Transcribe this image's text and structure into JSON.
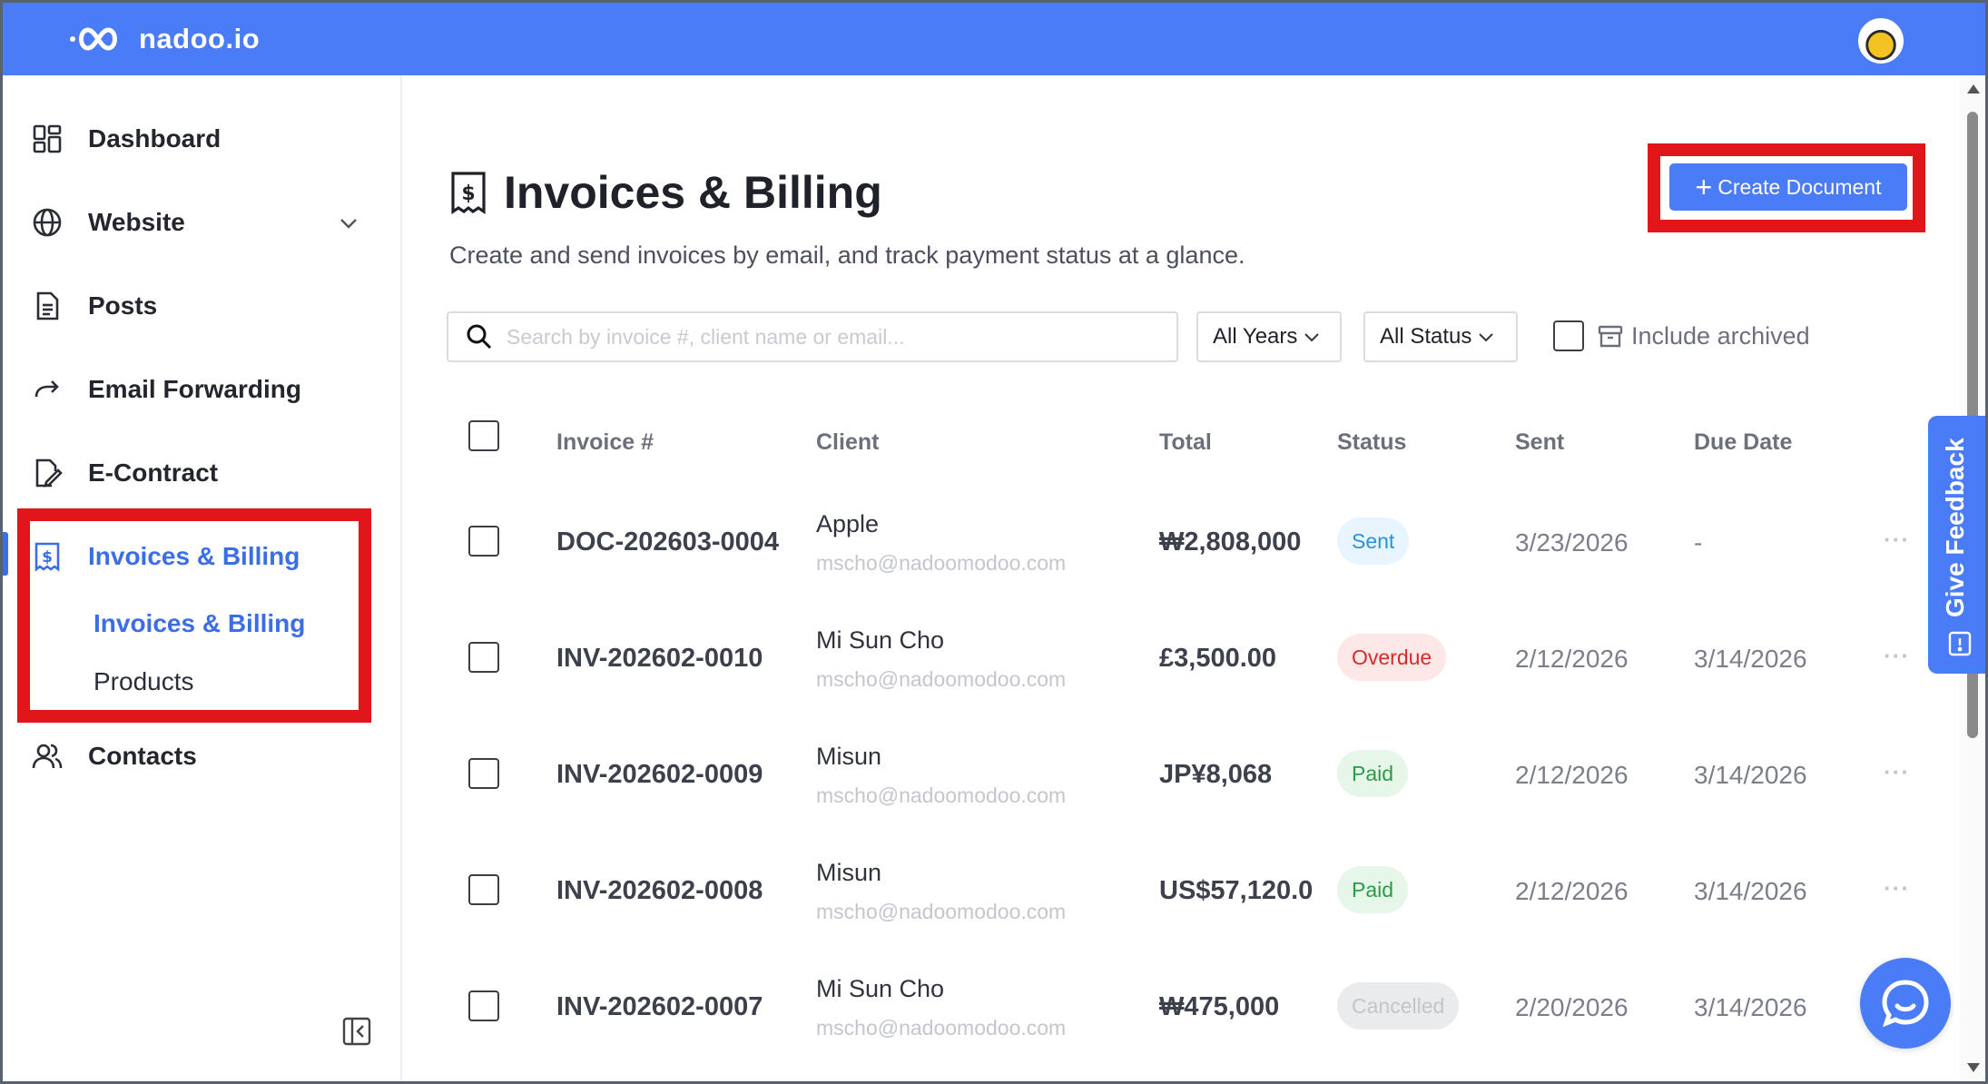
{
  "app": {
    "brand": "nadoo.io"
  },
  "sidebar": {
    "items": [
      {
        "label": "Dashboard",
        "icon": "dashboard-grid-icon"
      },
      {
        "label": "Website",
        "icon": "globe-icon"
      },
      {
        "label": "Posts",
        "icon": "document-icon"
      },
      {
        "label": "Email Forwarding",
        "icon": "forward-arrow-icon"
      },
      {
        "label": "E-Contract",
        "icon": "contract-pen-icon"
      },
      {
        "label": "Invoices & Billing",
        "icon": "invoice-dollar-icon"
      },
      {
        "label": "Contacts",
        "icon": "users-icon"
      }
    ],
    "subitems": [
      {
        "label": "Invoices & Billing"
      },
      {
        "label": "Products"
      }
    ]
  },
  "page": {
    "title": "Invoices & Billing",
    "subtitle": "Create and send invoices by email, and track payment status at a glance.",
    "create_label": "Create Document"
  },
  "filters": {
    "search_placeholder": "Search by invoice #, client name or email...",
    "years_label": "All Years",
    "status_label": "All Status",
    "archived_label": "Include archived"
  },
  "table": {
    "columns": [
      "Invoice #",
      "Client",
      "Total",
      "Status",
      "Sent",
      "Due Date"
    ],
    "rows": [
      {
        "invoice": "DOC-202603-0004",
        "client": "Apple",
        "email": "mscho@nadoomodoo.com",
        "total": "₩2,808,000",
        "status": "Sent",
        "sent": "3/23/2026",
        "due": "-"
      },
      {
        "invoice": "INV-202602-0010",
        "client": "Mi Sun Cho",
        "email": "mscho@nadoomodoo.com",
        "total": "£3,500.00",
        "status": "Overdue",
        "sent": "2/12/2026",
        "due": "3/14/2026"
      },
      {
        "invoice": "INV-202602-0009",
        "client": "Misun",
        "email": "mscho@nadoomodoo.com",
        "total": "JP¥8,068",
        "status": "Paid",
        "sent": "2/12/2026",
        "due": "3/14/2026"
      },
      {
        "invoice": "INV-202602-0008",
        "client": "Misun",
        "email": "mscho@nadoomodoo.com",
        "total": "US$57,120.0",
        "status": "Paid",
        "sent": "2/12/2026",
        "due": "3/14/2026"
      },
      {
        "invoice": "INV-202602-0007",
        "client": "Mi Sun Cho",
        "email": "mscho@nadoomodoo.com",
        "total": "₩475,000",
        "status": "Cancelled",
        "sent": "2/20/2026",
        "due": "3/14/2026"
      }
    ],
    "more_label": "···"
  },
  "feedback": {
    "label": "Give Feedback"
  },
  "colors": {
    "brand": "#4a7cf7",
    "highlight": "#e0161b",
    "active_nav": "#3b6de8"
  }
}
